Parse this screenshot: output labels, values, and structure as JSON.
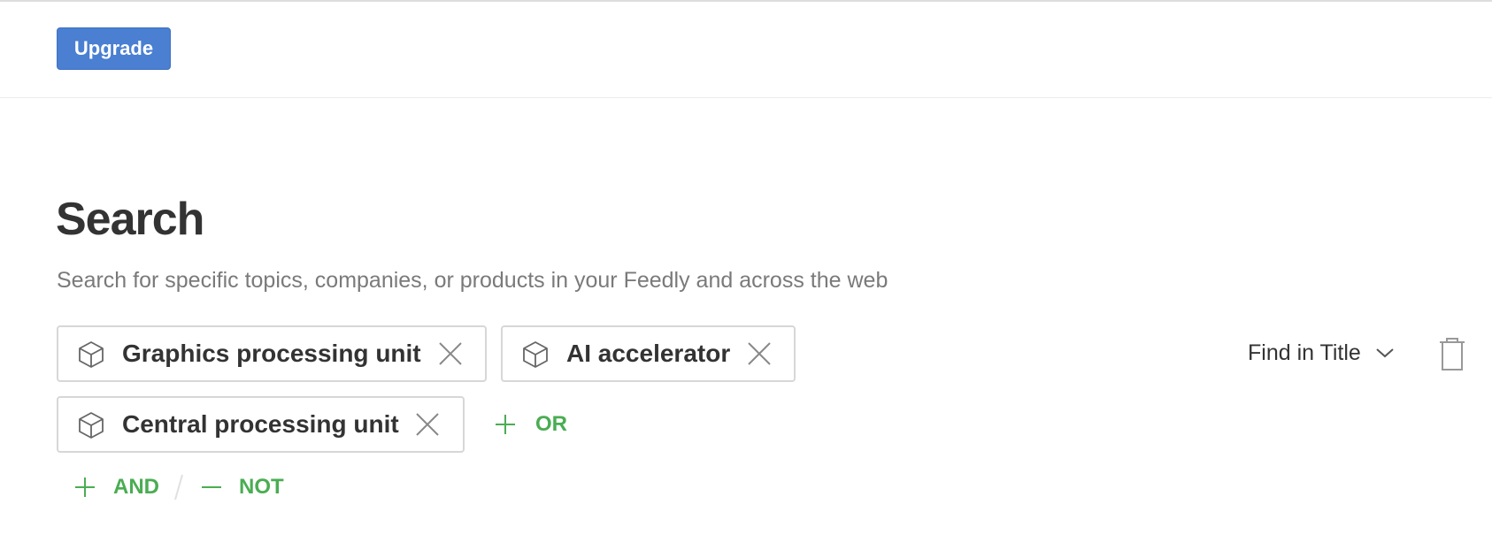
{
  "topbar": {
    "upgrade_label": "Upgrade"
  },
  "search": {
    "title": "Search",
    "subtitle": "Search for specific topics, companies, or products in your Feedly and across the web",
    "scope_selected": "Find in Title",
    "terms": [
      {
        "label": "Graphics processing unit",
        "icon": "cube-icon"
      },
      {
        "label": "AI accelerator",
        "icon": "cube-icon"
      },
      {
        "label": "Central processing unit",
        "icon": "cube-icon"
      }
    ],
    "or_label": "OR",
    "and_label": "AND",
    "not_label": "NOT"
  },
  "colors": {
    "accent_blue": "#4a7fd2",
    "accent_green": "#4aad52",
    "chip_border": "#d7d7d7",
    "text_dark": "#333333",
    "text_muted": "#7a7a7a"
  }
}
